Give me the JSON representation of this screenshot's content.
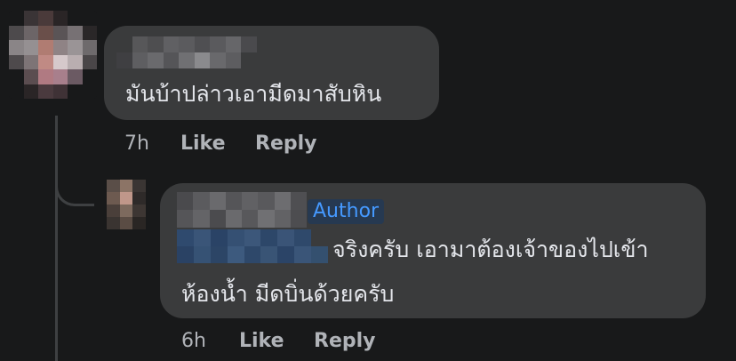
{
  "comments": [
    {
      "text": "มันบ้าปล่าวเอามีดมาสับหิน",
      "time": "7h",
      "like_label": "Like",
      "reply_label": "Reply"
    },
    {
      "badge": "Author",
      "text_line1": "จริงครับ เอามาต้องเจ้าของไปเข้า",
      "text_line2": "ห้องน้ำ มีดบิ่นด้วยครับ",
      "time": "6h",
      "like_label": "Like",
      "reply_label": "Reply"
    }
  ],
  "colors": {
    "background": "#18191a",
    "bubble": "#3a3b3c",
    "text_primary": "#e4e6eb",
    "text_secondary": "#b0b3b8",
    "author_badge_text": "#4599ff",
    "author_badge_bg": "#263951"
  }
}
